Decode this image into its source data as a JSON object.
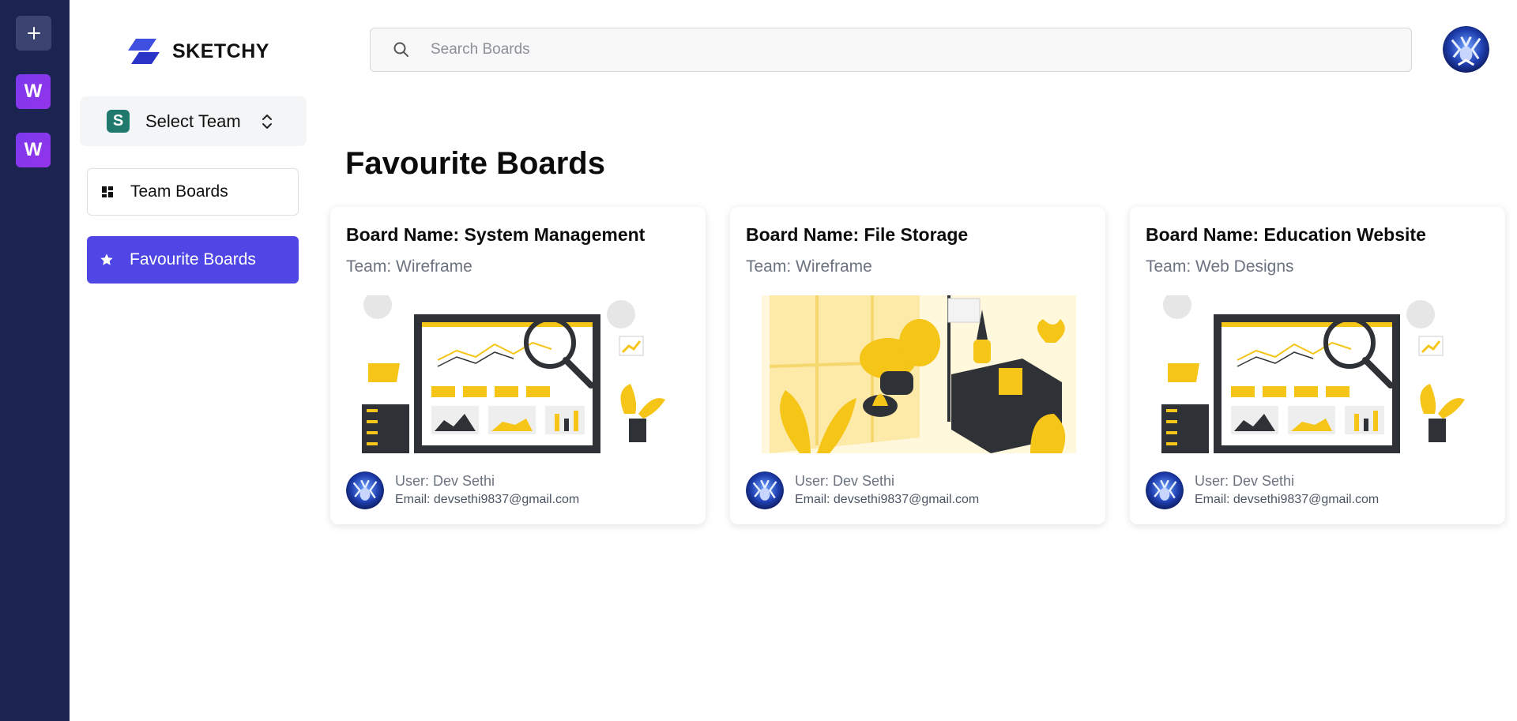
{
  "app": {
    "name": "SKETCHY"
  },
  "rail": {
    "teams": [
      "W",
      "W"
    ]
  },
  "sidebar": {
    "team_select": {
      "avatar_letter": "S",
      "label": "Select Team"
    },
    "nav": [
      {
        "label": "Team Boards",
        "icon": "dashboard-icon",
        "active": false
      },
      {
        "label": "Favourite Boards",
        "icon": "star-icon",
        "active": true
      }
    ]
  },
  "search": {
    "placeholder": "Search Boards",
    "value": ""
  },
  "main": {
    "title": "Favourite Boards",
    "boards": [
      {
        "name": "Board Name: System Management",
        "team": "Team: Wireframe",
        "illustration": "dashboard-analytics",
        "user": "User: Dev Sethi",
        "email": "Email: devsethi9837@gmail.com"
      },
      {
        "name": "Board Name: File Storage",
        "team": "Team: Wireframe",
        "illustration": "room-interior",
        "user": "User: Dev Sethi",
        "email": "Email: devsethi9837@gmail.com"
      },
      {
        "name": "Board Name: Education Website",
        "team": "Team: Web Designs",
        "illustration": "dashboard-analytics",
        "user": "User: Dev Sethi",
        "email": "Email: devsethi9837@gmail.com"
      }
    ]
  },
  "colors": {
    "rail": "#1b2350",
    "accent": "#4f46e5",
    "team_badge": "#7c3aed",
    "illustration": "#f5c518"
  }
}
